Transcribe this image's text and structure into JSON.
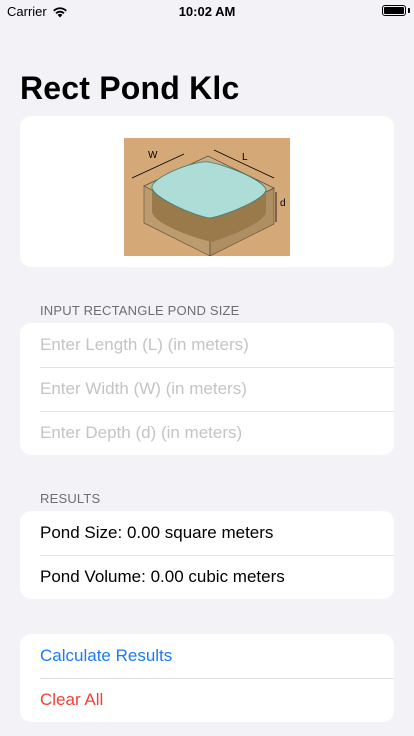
{
  "status_bar": {
    "carrier": "Carrier",
    "time": "10:02 AM"
  },
  "page": {
    "title": "Rect Pond Klc"
  },
  "diagram": {
    "width_label": "W",
    "length_label": "L",
    "depth_label": "d"
  },
  "inputs": {
    "header": "INPUT RECTANGLE POND SIZE",
    "length_placeholder": "Enter Length (L) (in meters)",
    "width_placeholder": "Enter Width (W) (in meters)",
    "depth_placeholder": "Enter Depth (d) (in meters)"
  },
  "results": {
    "header": "RESULTS",
    "pond_size": "Pond Size: 0.00 square meters",
    "pond_volume": "Pond Volume: 0.00 cubic meters"
  },
  "actions": {
    "calculate": "Calculate Results",
    "clear": "Clear All"
  }
}
